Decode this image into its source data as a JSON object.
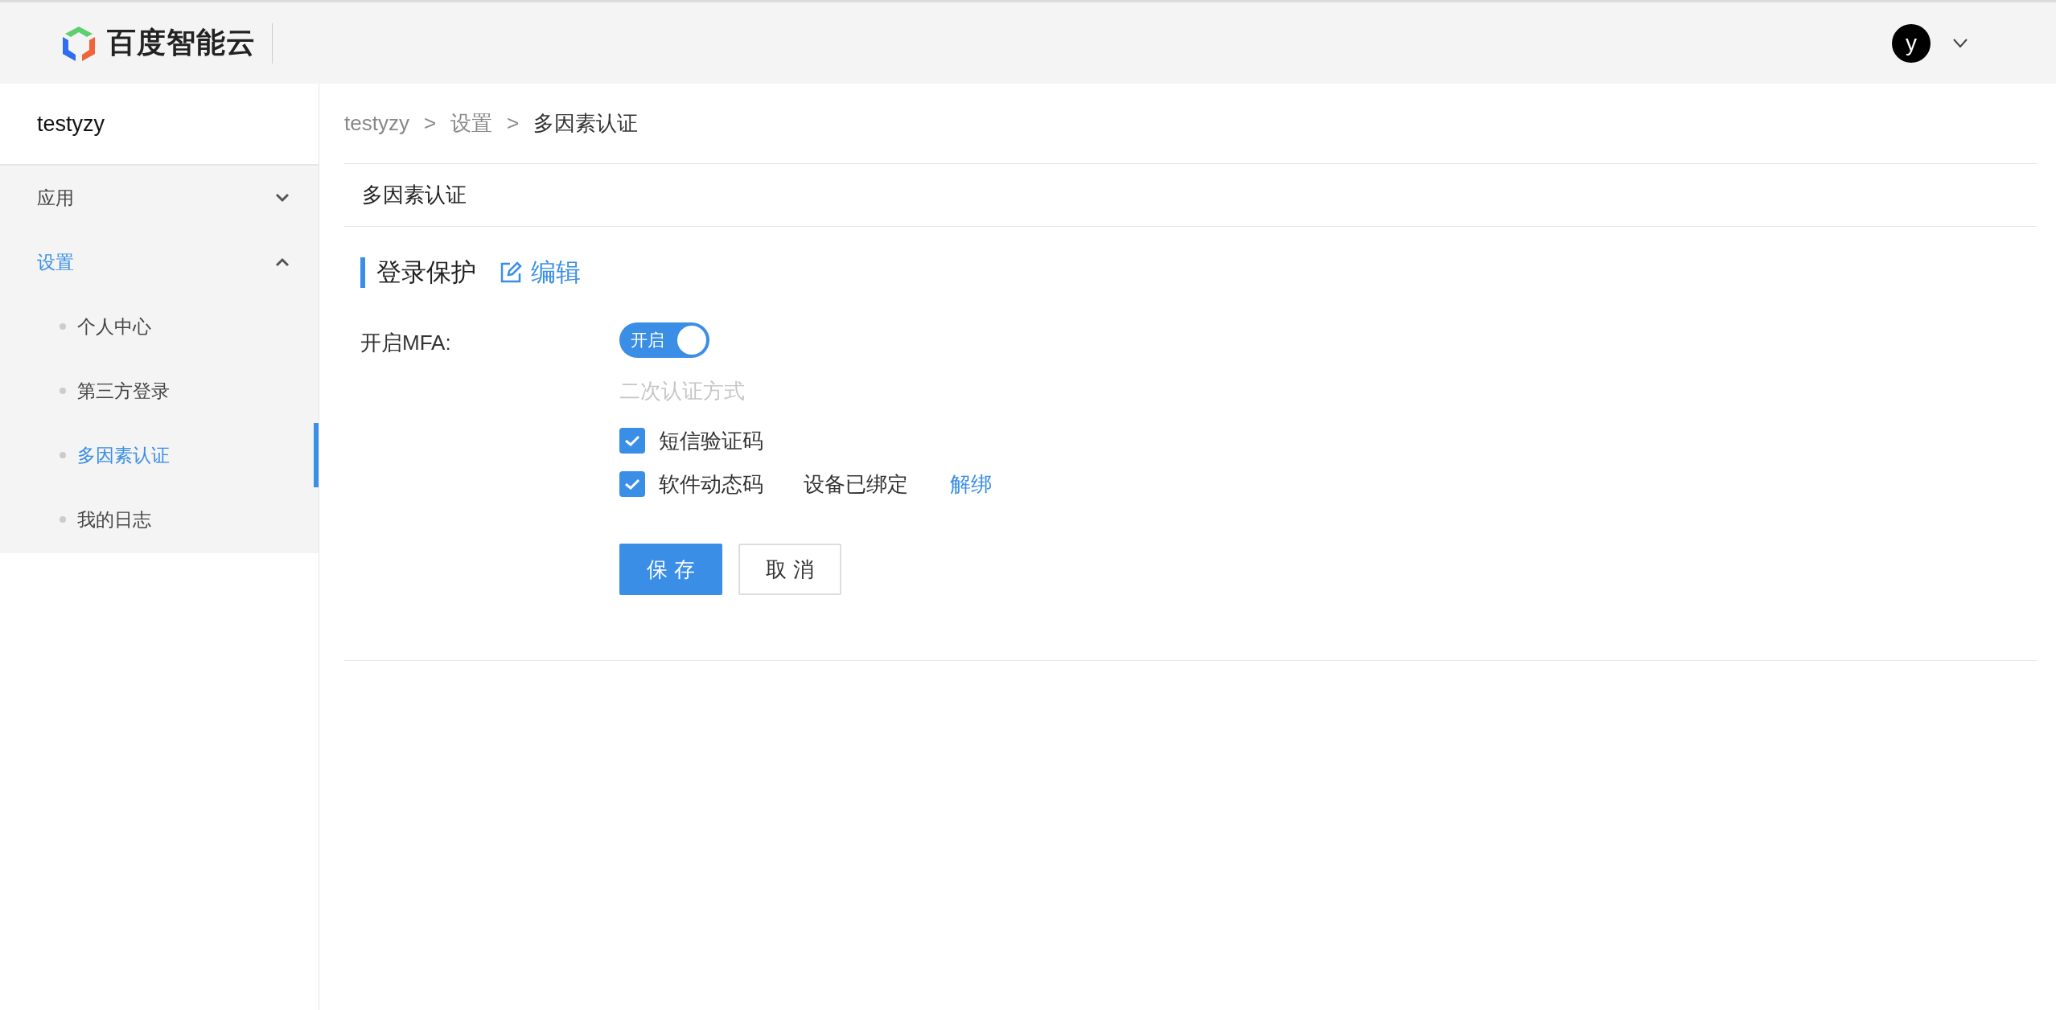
{
  "header": {
    "logo_text": "百度智能云",
    "avatar_letter": "y"
  },
  "sidebar": {
    "user": "testyzy",
    "menu": [
      {
        "label": "应用",
        "expanded": false,
        "selected": false
      },
      {
        "label": "设置",
        "expanded": true,
        "selected": true,
        "children": [
          {
            "label": "个人中心",
            "selected": false
          },
          {
            "label": "第三方登录",
            "selected": false
          },
          {
            "label": "多因素认证",
            "selected": true
          },
          {
            "label": "我的日志",
            "selected": false
          }
        ]
      }
    ]
  },
  "breadcrumb": [
    {
      "label": "testyzy"
    },
    {
      "label": "设置",
      "separator": ">"
    },
    {
      "label": "多因素认证",
      "separator": ">"
    }
  ],
  "page_title": "多因素认证",
  "section": {
    "title": "登录保护",
    "edit_link": "编辑"
  },
  "form": {
    "mfa_label": "开启MFA:",
    "toggle": {
      "on": true,
      "label": "开启"
    },
    "hint": "二次认证方式",
    "methods": [
      {
        "label": "短信验证码",
        "checked": true
      },
      {
        "label": "软件动态码",
        "checked": true,
        "status": "设备已绑定",
        "action": "解绑"
      }
    ],
    "buttons": [
      {
        "label": "保 存",
        "kind": "primary"
      },
      {
        "label": "取 消",
        "kind": "default"
      }
    ]
  }
}
